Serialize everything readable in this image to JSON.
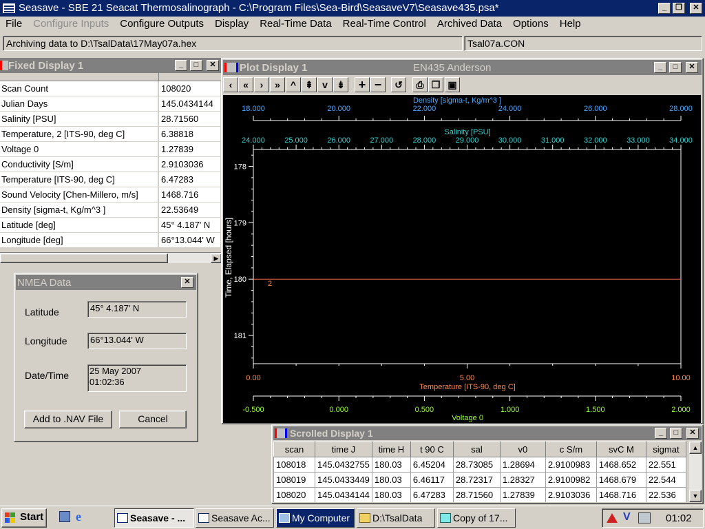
{
  "app": {
    "title": "Seasave - SBE 21 Seacat Thermosalinograph - C:\\Program Files\\Sea-Bird\\SeasaveV7\\Seasave435.psa*",
    "icon": "SBE-logo-icon"
  },
  "menu": [
    "File",
    "Configure Inputs",
    "Configure Outputs",
    "Display",
    "Real-Time Data",
    "Real-Time Control",
    "Archived Data",
    "Options",
    "Help"
  ],
  "status": {
    "archiving": "Archiving data to D:\\TsalData\\17May07a.hex",
    "config": "Tsal07a.CON"
  },
  "fixed_display": {
    "title": "Fixed Display 1",
    "rows": [
      {
        "label": "Scan Count",
        "value": "108020"
      },
      {
        "label": "Julian Days",
        "value": "145.0434144"
      },
      {
        "label": "Salinity [PSU]",
        "value": "28.71560"
      },
      {
        "label": "Temperature, 2 [ITS-90, deg C]",
        "value": "6.38818"
      },
      {
        "label": "Voltage 0",
        "value": "1.27839"
      },
      {
        "label": "Conductivity [S/m]",
        "value": "2.9103036"
      },
      {
        "label": "Temperature [ITS-90, deg C]",
        "value": "6.47283"
      },
      {
        "label": "Sound Velocity [Chen-Millero, m/s]",
        "value": "1468.716"
      },
      {
        "label": "Density [sigma-t, Kg/m^3 ]",
        "value": "22.53649"
      },
      {
        "label": "Latitude [deg]",
        "value": " 45° 4.187' N"
      },
      {
        "label": "Longitude [deg]",
        "value": " 66°13.044' W"
      }
    ]
  },
  "nmea": {
    "title": "NMEA Data",
    "latitude_label": "Latitude",
    "latitude_value": "45° 4.187' N",
    "longitude_label": "Longitude",
    "longitude_value": "66°13.044' W",
    "datetime_label": "Date/Time",
    "date_value": "25 May 2007",
    "time_value": "01:02:36",
    "add_button": "Add to .NAV File",
    "cancel_button": "Cancel"
  },
  "plot": {
    "title": "Plot Display 1",
    "subtitle": "EN435 Anderson",
    "colors": {
      "density": "#4aa8ff",
      "salinity": "#3ad0d0",
      "time": "#ffffff",
      "temperature": "#ff8a50",
      "voltage": "#9aff3a",
      "line": "#ff6a50"
    }
  },
  "chart_data": {
    "type": "line",
    "axes": {
      "density": {
        "label": "Density [sigma-t, Kg/m^3 ]",
        "range": [
          18,
          28
        ],
        "ticks": [
          "18.000",
          "20.000",
          "22.000",
          "24.000",
          "26.000",
          "28.000"
        ]
      },
      "salinity": {
        "label": "Salinity [PSU]",
        "range": [
          24,
          34
        ],
        "ticks": [
          "24.000",
          "25.000",
          "26.000",
          "27.000",
          "28.000",
          "29.000",
          "30.000",
          "31.000",
          "32.000",
          "33.000",
          "34.000"
        ]
      },
      "time": {
        "label": "Time, Elapsed [hours]",
        "range": [
          177.7,
          181.5
        ],
        "ticks": [
          "178",
          "179",
          "180",
          "181"
        ]
      },
      "temperature": {
        "label": "Temperature [ITS-90, deg C]",
        "range": [
          0,
          10
        ],
        "ticks": [
          "0.00",
          "5.00",
          "10.00"
        ]
      },
      "voltage": {
        "label": "Voltage 0",
        "range": [
          -0.5,
          2.0
        ],
        "ticks": [
          "-0.500",
          "0.000",
          "0.500",
          "1.000",
          "1.500",
          "2.000"
        ]
      }
    },
    "annotation": "2",
    "series": [
      {
        "axis": "temperature",
        "x": [
          0,
          10
        ],
        "y": [
          180.0,
          180.0
        ]
      }
    ]
  },
  "scrolled": {
    "title": "Scrolled Display 1",
    "columns": [
      "scan",
      "time J",
      "time H",
      "t 90 C",
      "sal",
      "v0",
      "c S/m",
      "svC M",
      "sigmat"
    ],
    "rows": [
      [
        "108018",
        "145.0432755",
        "180.03",
        "6.45204",
        "28.73085",
        "1.28694",
        "2.9100983",
        "1468.652",
        "22.551"
      ],
      [
        "108019",
        "145.0433449",
        "180.03",
        "6.46117",
        "28.72317",
        "1.28327",
        "2.9100982",
        "1468.679",
        "22.544"
      ],
      [
        "108020",
        "145.0434144",
        "180.03",
        "6.47283",
        "28.71560",
        "1.27839",
        "2.9103036",
        "1468.716",
        "22.536"
      ]
    ]
  },
  "taskbar": {
    "start": "Start",
    "tasks": [
      {
        "label": "Seasave - ...",
        "icon": "SBE-logo-icon"
      },
      {
        "label": "Seasave Ac...",
        "icon": "SBE-logo-icon"
      },
      {
        "label": "My Computer",
        "icon": "computer-icon"
      },
      {
        "label": "D:\\TsalData",
        "icon": "folder-search-icon"
      },
      {
        "label": "Copy of 17...",
        "icon": "notepad-icon"
      }
    ],
    "clock": "01:02"
  }
}
